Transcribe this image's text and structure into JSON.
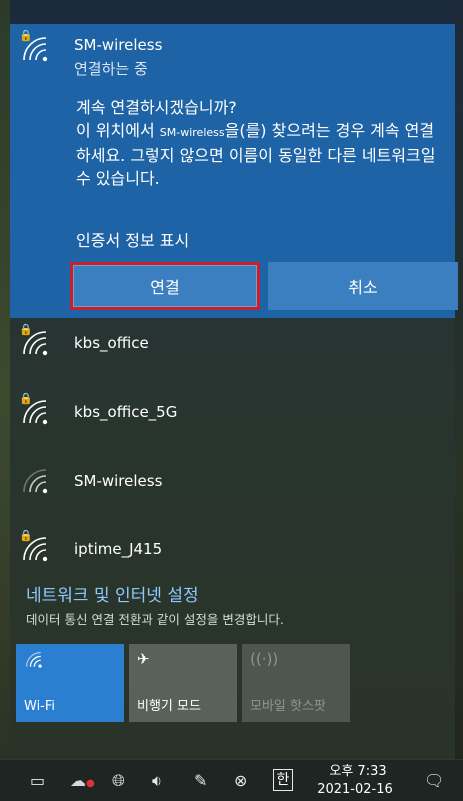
{
  "selected_network": {
    "name": "SM-wireless",
    "status": "연결하는 중",
    "message_line1": "계속 연결하시겠습니까?",
    "message_line2a": "이 위치에서 ",
    "message_line2_ssid": "SM-wireless",
    "message_line2b": "을(를) 찾으려는 경우 계속 연결하세요. 그렇지 않으면 이름이 동일한 다른 네트워크일 수 있습니다.",
    "cert_link": "인증서 정보 표시",
    "connect_button": "연결",
    "cancel_button": "취소"
  },
  "networks": [
    {
      "name": "kbs_office",
      "secured": true
    },
    {
      "name": "kbs_office_5G",
      "secured": true
    },
    {
      "name": "SM-wireless",
      "secured": false
    },
    {
      "name": "iptime_J415",
      "secured": true
    }
  ],
  "settings": {
    "link": "네트워크 및 인터넷 설정",
    "description": "데이터 통신 연결 전환과 같이 설정을 변경합니다."
  },
  "quick_actions": {
    "wifi": {
      "label": "Wi-Fi",
      "icon": "wifi-icon",
      "active": true
    },
    "airplane": {
      "label": "비행기 모드",
      "icon": "airplane-icon",
      "active": false
    },
    "hotspot": {
      "label": "모바일 핫스팟",
      "icon": "hotspot-icon",
      "active": false
    }
  },
  "taskbar": {
    "time": "오후 7:33",
    "date": "2021-02-16",
    "ime": "한"
  },
  "colors": {
    "accent": "#1e63a6",
    "button": "#3b7fc0",
    "highlight_border": "#c8202b",
    "link": "#8ec8ff"
  }
}
